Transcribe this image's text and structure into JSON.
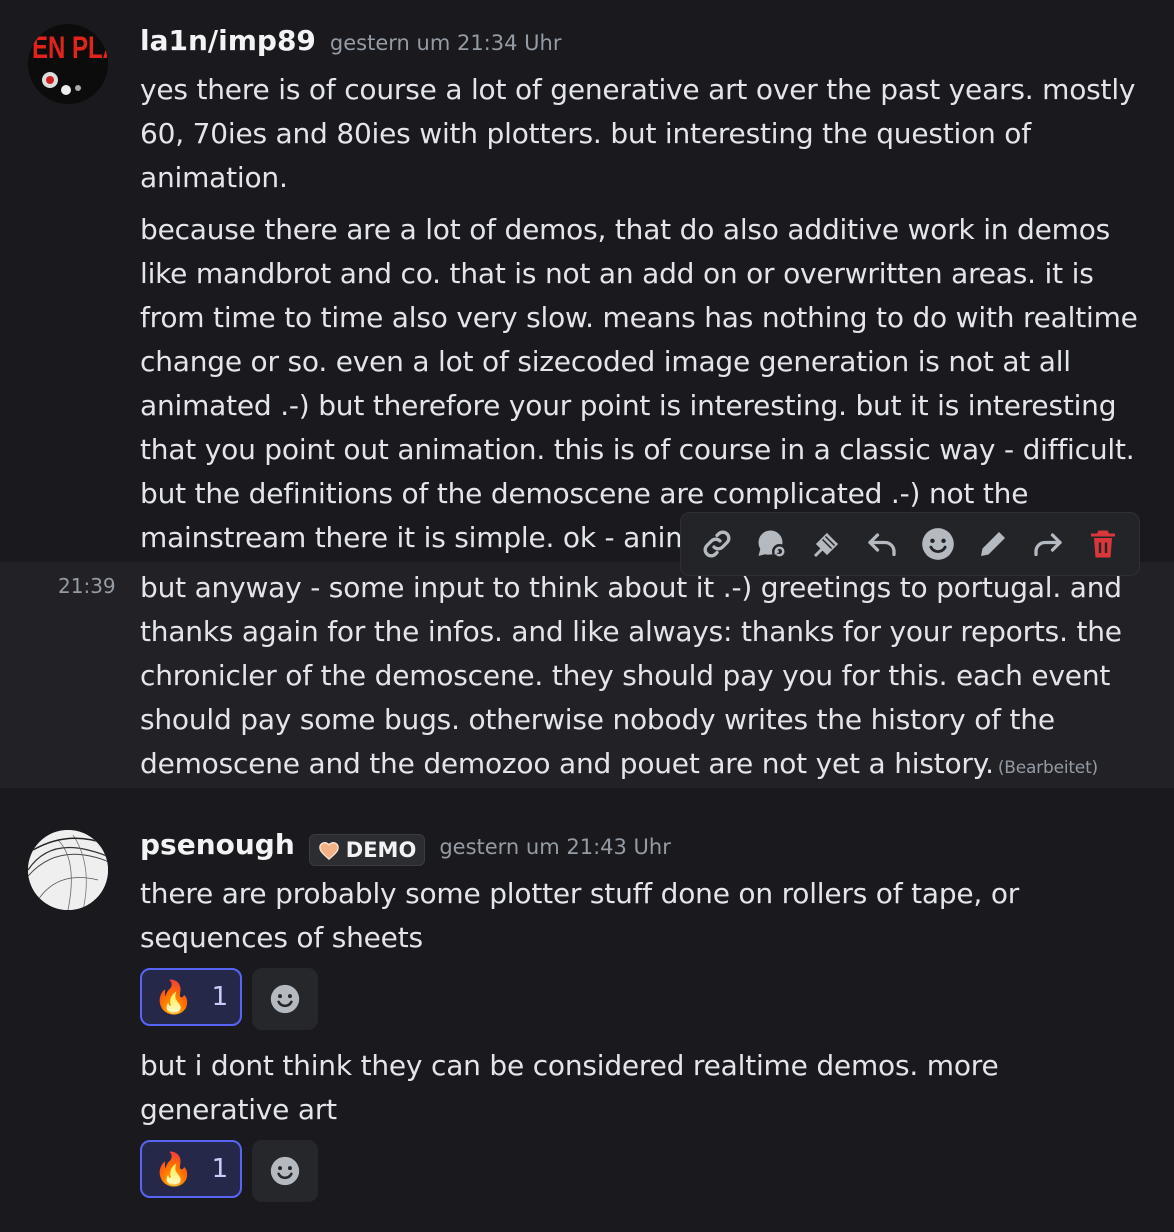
{
  "messages": [
    {
      "username": "la1n/imp89",
      "timestamp": "gestern um 21:34 Uhr",
      "avatar_text": "VEN PLA",
      "paragraphs": [
        "yes there is of course a lot of generative art over the past years. mostly 60, 70ies and 80ies with plotters. but interesting the question of animation.",
        "because there are a lot of demos, that do also additive work in demos like mandbrot and co. that is not an add on or overwritten areas. it is from time to time also very slow. means has nothing to do with realtime change or so. even a lot of sizecoded image generation is not at all animated .-) but therefore your point is interesting. but it is interesting that you point out animation. this is of course in a classic way - difficult. but the definitions of the demoscene are complicated .-) not the mainstream there it is simple. ok - anima"
      ],
      "followup": {
        "side_time": "21:39",
        "text": "but anyway - some input to think about it .-) greetings to portugal. and thanks again for the infos. and like always: thanks for your reports. the chronicler of the demoscene. they should pay you for this. each event should pay some bugs. otherwise nobody writes the history of the demoscene and the demozoo and pouet are not yet a history.",
        "edited": "(Bearbeitet)"
      }
    },
    {
      "username": "psenough",
      "badge": "DEMO",
      "timestamp": "gestern um 21:43 Uhr",
      "blocks": [
        {
          "text": "there are probably some plotter stuff done on rollers of tape, or sequences of sheets",
          "reaction_emoji": "🔥",
          "reaction_count": "1"
        },
        {
          "text": "but i dont think they can be considered realtime demos. more generative art",
          "reaction_emoji": "🔥",
          "reaction_count": "1"
        }
      ]
    }
  ],
  "toolbar": [
    "copy-link-icon",
    "thread-icon",
    "pin-icon",
    "reply-icon",
    "add-reaction-icon",
    "edit-icon",
    "forward-icon",
    "delete-icon"
  ],
  "colors": {
    "accent": "#5865f2",
    "danger": "#da373c",
    "background": "#1a1a1e"
  }
}
